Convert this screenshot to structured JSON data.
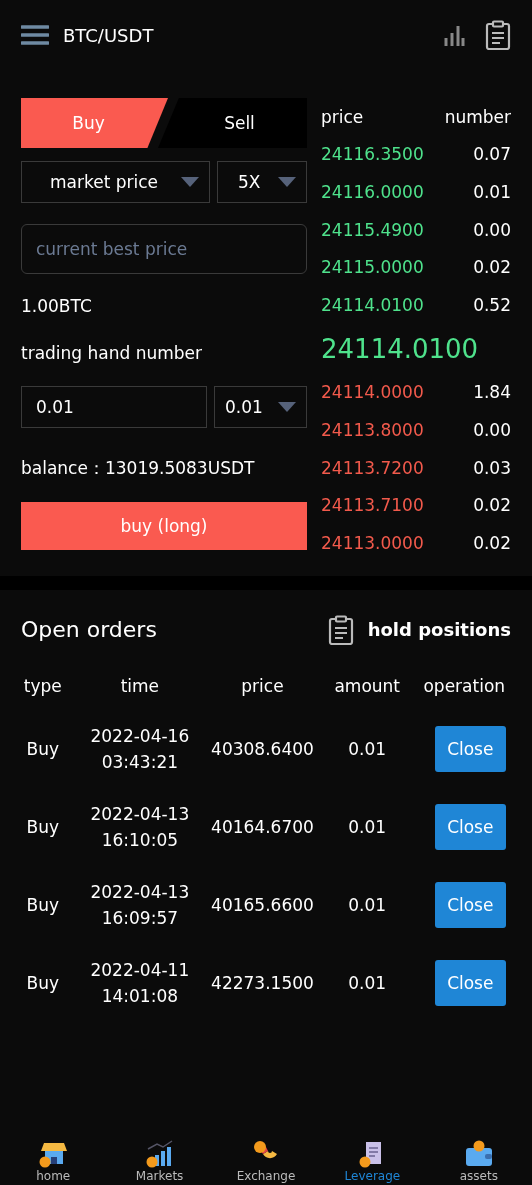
{
  "header": {
    "pair": "BTC/USDT"
  },
  "trade": {
    "side_tabs": [
      {
        "label": "Buy",
        "selected": true
      },
      {
        "label": "Sell",
        "selected": false
      }
    ],
    "order_type": "market price",
    "leverage": "5X",
    "price_placeholder": "current best price",
    "amount": "1.00BTC",
    "hand_label": "trading hand number",
    "hand_value": "0.01",
    "hand_step": "0.01",
    "balance_label": "balance：",
    "balance_value": "13019.5083USDT",
    "submit": "buy (long)"
  },
  "order_book": {
    "columns": [
      "price",
      "number"
    ],
    "asks": [
      {
        "price": "24116.3500",
        "number": "0.07"
      },
      {
        "price": "24116.0000",
        "number": "0.01"
      },
      {
        "price": "24115.4900",
        "number": "0.00"
      },
      {
        "price": "24115.0000",
        "number": "0.02"
      },
      {
        "price": "24114.0100",
        "number": "0.52"
      }
    ],
    "last_price": "24114.0100",
    "bids": [
      {
        "price": "24114.0000",
        "number": "1.84"
      },
      {
        "price": "24113.8000",
        "number": "0.00"
      },
      {
        "price": "24113.7200",
        "number": "0.03"
      },
      {
        "price": "24113.7100",
        "number": "0.02"
      },
      {
        "price": "24113.0000",
        "number": "0.02"
      }
    ]
  },
  "orders": {
    "title": "Open orders",
    "hold_positions": "hold positions",
    "columns": [
      "type",
      "time",
      "price",
      "amount",
      "operation"
    ],
    "rows": [
      {
        "type": "Buy",
        "date": "2022-04-16",
        "time": "03:43:21",
        "price": "40308.6400",
        "amount": "0.01",
        "action": "Close"
      },
      {
        "type": "Buy",
        "date": "2022-04-13",
        "time": "16:10:05",
        "price": "40164.6700",
        "amount": "0.01",
        "action": "Close"
      },
      {
        "type": "Buy",
        "date": "2022-04-13",
        "time": "16:09:57",
        "price": "40165.6600",
        "amount": "0.01",
        "action": "Close"
      },
      {
        "type": "Buy",
        "date": "2022-04-11",
        "time": "14:01:08",
        "price": "42273.1500",
        "amount": "0.01",
        "action": "Close"
      }
    ]
  },
  "nav": [
    {
      "label": "home",
      "kind": "home",
      "selected": false
    },
    {
      "label": "Markets",
      "kind": "markets",
      "selected": false
    },
    {
      "label": "Exchange",
      "kind": "exchange",
      "selected": false
    },
    {
      "label": "Leverage",
      "kind": "leverage",
      "selected": true
    },
    {
      "label": "assets",
      "kind": "assets",
      "selected": false
    }
  ]
}
